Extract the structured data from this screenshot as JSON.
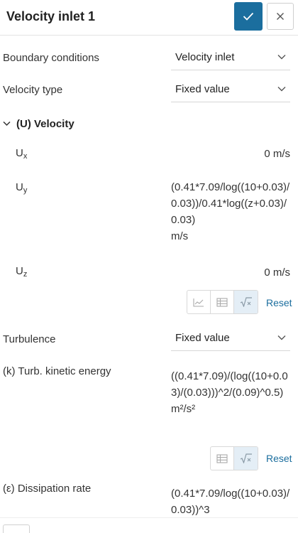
{
  "dialog": {
    "title": "Velocity inlet 1"
  },
  "fields": {
    "boundary_conditions": {
      "label": "Boundary conditions",
      "value": "Velocity inlet"
    },
    "velocity_type": {
      "label": "Velocity type",
      "value": "Fixed value"
    }
  },
  "velocity": {
    "section_label": "(U) Velocity",
    "ux": {
      "label_main": "U",
      "label_sub": "x",
      "value": "0 m/s"
    },
    "uy": {
      "label_main": "U",
      "label_sub": "y",
      "expression": "(0.41*7.09/log((10+0.03)/0.03))/0.41*log((z+0.03)/0.03)",
      "unit": "m/s"
    },
    "uz": {
      "label_main": "U",
      "label_sub": "z",
      "value": "0 m/s"
    },
    "reset_label": "Reset"
  },
  "turbulence": {
    "label": "Turbulence",
    "value": "Fixed value",
    "k": {
      "label": "(k) Turb. kinetic energy",
      "expression": "((0.41*7.09)/(log((10+0.03)/(0.03)))^2/(0.09)^0.5)",
      "unit": "m²/s²",
      "reset_label": "Reset"
    },
    "epsilon": {
      "label": "(ε) Dissipation rate",
      "expression": "(0.41*7.09/log((10+0.03)/0.03))^3"
    }
  },
  "icons": {
    "confirm": "check-icon",
    "close": "close-icon",
    "dropdown": "chevron-down-icon",
    "collapse": "chevron-down-icon",
    "chart": "line-chart-icon",
    "table": "table-icon",
    "formula": "formula-icon"
  },
  "colors": {
    "accent": "#1b6e9e",
    "active_tool": "#e4eef6"
  }
}
